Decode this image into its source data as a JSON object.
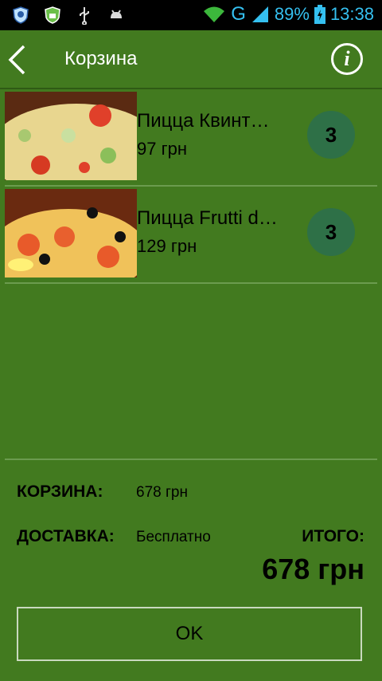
{
  "statusbar": {
    "signal_type": "G",
    "battery": "89%",
    "time": "13:38"
  },
  "actionbar": {
    "title": "Корзина"
  },
  "items": [
    {
      "name": "Пицца Квинт…",
      "price": "97 грн",
      "qty": "3"
    },
    {
      "name": "Пицца Frutti d…",
      "price": "129 грн",
      "qty": "3"
    }
  ],
  "summary": {
    "cart_label": "КОРЗИНА:",
    "cart_value": "678 грн",
    "delivery_label": "ДОСТАВКА:",
    "delivery_value": "Бесплатно",
    "total_label": "ИТОГО:",
    "total_value": "678 грн"
  },
  "ok_button": "OK",
  "colors": {
    "background": "#427a1f",
    "qty_badge": "#2e7047",
    "status_icons": "#35c0f0"
  }
}
